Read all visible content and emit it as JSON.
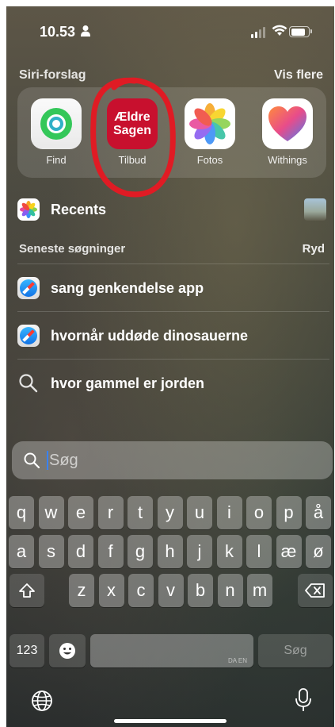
{
  "status": {
    "time": "10.53"
  },
  "siri": {
    "title": "Siri-forslag",
    "more": "Vis flere",
    "apps": [
      {
        "label": "Find",
        "icon": "find-my-icon"
      },
      {
        "label": "Tilbud",
        "icon": "aeldre-sagen-icon",
        "icon_text_line1": "Ældre",
        "icon_text_line2": "Sagen"
      },
      {
        "label": "Fotos",
        "icon": "photos-icon"
      },
      {
        "label": "Withings",
        "icon": "withings-heart-icon"
      }
    ],
    "annotation_color": "#e01b24"
  },
  "recents": {
    "label": "Recents"
  },
  "recent_searches": {
    "title": "Seneste søgninger",
    "clear": "Ryd",
    "items": [
      {
        "text": "sang genkendelse app",
        "icon": "safari-icon"
      },
      {
        "text": "hvornår uddøde dinosauerne",
        "icon": "safari-icon"
      },
      {
        "text": "hvor gammel er jorden",
        "icon": "search-icon"
      }
    ]
  },
  "search": {
    "placeholder": "Søg"
  },
  "keyboard": {
    "row1": [
      "q",
      "w",
      "e",
      "r",
      "t",
      "y",
      "u",
      "i",
      "o",
      "p",
      "å"
    ],
    "row2": [
      "a",
      "s",
      "d",
      "f",
      "g",
      "h",
      "j",
      "k",
      "l",
      "æ",
      "ø"
    ],
    "row3": [
      "z",
      "x",
      "c",
      "v",
      "b",
      "n",
      "m"
    ],
    "numbers": "123",
    "space_langs": "DA EN",
    "go": "Søg"
  },
  "colors": {
    "accent": "#3a82f7",
    "brand_red": "#c8102e"
  }
}
